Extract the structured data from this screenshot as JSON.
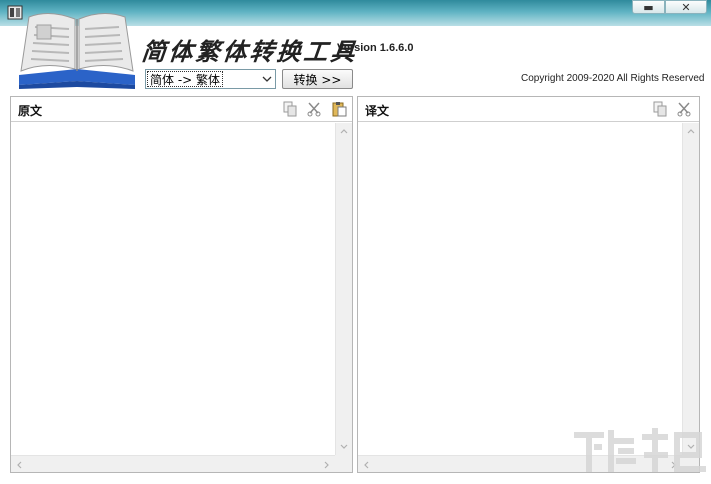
{
  "titlebar": {
    "minimize_glyph": "▬",
    "close_glyph": "✕"
  },
  "header": {
    "app_title": "简体繁体转换工具",
    "version": "Version 1.6.6.0",
    "mode_select_value": "简体 -> 繁体",
    "convert_button_label": "转换 >>",
    "copyright": "Copyright 2009-2020 All Rights Reserved"
  },
  "panels": {
    "source": {
      "title": "原文",
      "tools": [
        "copy-icon",
        "cut-icon",
        "paste-icon"
      ]
    },
    "target": {
      "title": "译文",
      "tools": [
        "copy-icon",
        "cut-icon"
      ]
    }
  },
  "colors": {
    "titlebar_start": "#2f8a9c",
    "titlebar_end": "#b9dfe6",
    "book_blue": "#2b63c8",
    "panel_border": "#b6b6b6"
  }
}
